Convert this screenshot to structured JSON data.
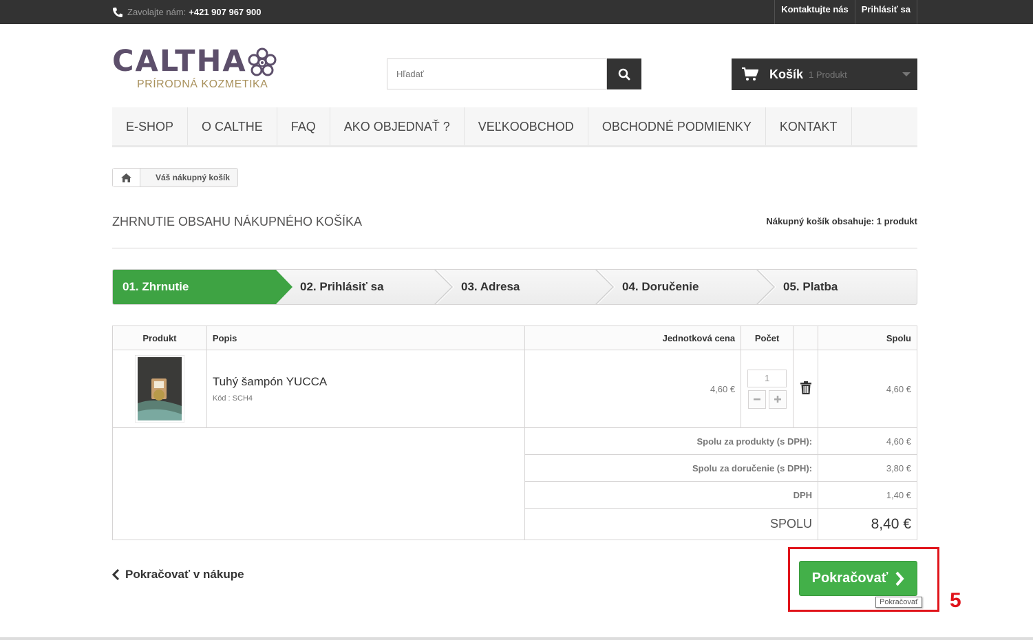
{
  "topbar": {
    "phone_label": "Zavolajte nám:",
    "phone_number": "+421 907 967 900",
    "links": [
      "Kontaktujte nás",
      "Prihlásiť sa"
    ]
  },
  "logo": {
    "name": "CALTHA",
    "tagline": "PRÍRODNÁ KOZMETIKA"
  },
  "search": {
    "placeholder": "Hľadať"
  },
  "cart": {
    "label": "Košík",
    "count": "1 Produkt"
  },
  "menu": [
    "E-SHOP",
    "O CALTHE",
    "FAQ",
    "AKO OBJEDNAŤ ?",
    "VEĽKOOBCHOD",
    "OBCHODNÉ PODMIENKY",
    "KONTAKT"
  ],
  "breadcrumb": {
    "current": "Váš nákupný košík"
  },
  "heading": {
    "title": "ZHRNUTIE OBSAHU NÁKUPNÉHO KOŠÍKA",
    "counter": "Nákupný košík obsahuje: 1 produkt"
  },
  "steps": [
    "01. Zhrnutie",
    "02. Prihlásiť sa",
    "03. Adresa",
    "04. Doručenie",
    "05. Platba"
  ],
  "table": {
    "headers": {
      "product": "Produkt",
      "description": "Popis",
      "unit_price": "Jednotková cena",
      "qty": "Počet",
      "total": "Spolu"
    },
    "item": {
      "name": "Tuhý šampón YUCCA",
      "ref": "Kód : SCH4",
      "unit_price": "4,60 €",
      "qty": "1",
      "total": "4,60 €"
    },
    "summary": [
      {
        "label": "Spolu za produkty (s DPH):",
        "value": "4,60 €"
      },
      {
        "label": "Spolu za doručenie (s DPH):",
        "value": "3,80 €"
      },
      {
        "label": "DPH",
        "value": "1,40 €"
      }
    ],
    "grand_total": {
      "label": "SPOLU",
      "value": "8,40 €"
    }
  },
  "actions": {
    "continue_shopping": "Pokračovať v nákupe",
    "proceed": "Pokračovať",
    "proceed_tooltip": "Pokračovať"
  },
  "annotation": {
    "step_number": "5"
  },
  "colors": {
    "accent_green": "#43b049",
    "dark": "#333333",
    "annotation_red": "#e0141b",
    "logo_purple": "#5d4f6b",
    "logo_gold": "#a9915c"
  }
}
